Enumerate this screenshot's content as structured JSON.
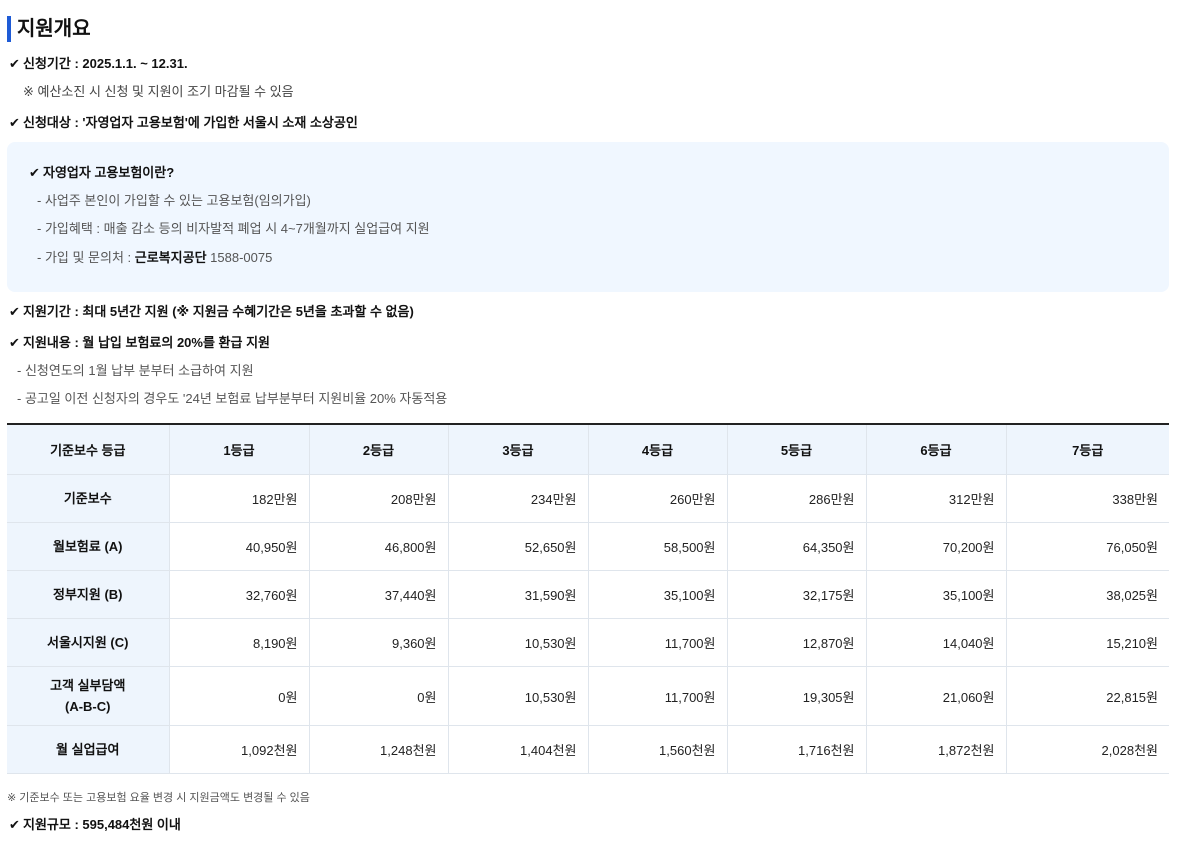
{
  "title": "지원개요",
  "period": {
    "label": "신청기간 : 2025.1.1. ~ 12.31.",
    "note": "※ 예산소진 시 신청 및 지원이 조기 마감될 수 있음"
  },
  "target": "신청대상 : '자영업자 고용보험'에 가입한 서울시 소재 소상공인",
  "info_box": {
    "heading": "자영업자 고용보험이란?",
    "items": [
      {
        "text": "-  사업주 본인이 가입할 수 있는 고용보험(임의가입)"
      },
      {
        "text": "-  가입혜택 : 매출 감소 등의 비자발적 폐업 시 4~7개월까지 실업급여 지원"
      },
      {
        "prefix": "-  가입 및 문의처 : ",
        "strong": "근로복지공단",
        "suffix": " 1588-0075"
      }
    ]
  },
  "duration": "지원기간 : 최대 5년간 지원 (※ 지원금 수혜기간은 5년을 초과할 수 없음)",
  "content": {
    "label": "지원내용 : 월 납입 보험료의 20%를 환급 지원",
    "items": [
      "-  신청연도의 1월 납부 분부터 소급하여 지원",
      "-  공고일 이전 신청자의 경우도 '24년 보험료 납부분부터 지원비율 20% 자동적용"
    ]
  },
  "table": {
    "headers": [
      "기준보수 등급",
      "1등급",
      "2등급",
      "3등급",
      "4등급",
      "5등급",
      "6등급",
      "7등급"
    ],
    "rows": [
      {
        "label": "기준보수",
        "cells": [
          "182만원",
          "208만원",
          "234만원",
          "260만원",
          "286만원",
          "312만원",
          "338만원"
        ]
      },
      {
        "label": "월보험료 (A)",
        "cells": [
          "40,950원",
          "46,800원",
          "52,650원",
          "58,500원",
          "64,350원",
          "70,200원",
          "76,050원"
        ]
      },
      {
        "label": "정부지원 (B)",
        "cells": [
          "32,760원",
          "37,440원",
          "31,590원",
          "35,100원",
          "32,175원",
          "35,100원",
          "38,025원"
        ]
      },
      {
        "label": "서울시지원 (C)",
        "cells": [
          "8,190원",
          "9,360원",
          "10,530원",
          "11,700원",
          "12,870원",
          "14,040원",
          "15,210원"
        ]
      },
      {
        "label_line1": "고객 실부담액",
        "label_line2": "(A-B-C)",
        "cells": [
          "0원",
          "0원",
          "10,530원",
          "11,700원",
          "19,305원",
          "21,060원",
          "22,815원"
        ]
      },
      {
        "label": "월 실업급여",
        "cells": [
          "1,092천원",
          "1,248천원",
          "1,404천원",
          "1,560천원",
          "1,716천원",
          "1,872천원",
          "2,028천원"
        ]
      }
    ]
  },
  "footnote": "※ 기준보수 또는 고용보험 요율 변경 시 지원금액도 변경될 수 있음",
  "scale": "지원규모 : 595,484천원 이내",
  "icons": {
    "check": "✔"
  }
}
